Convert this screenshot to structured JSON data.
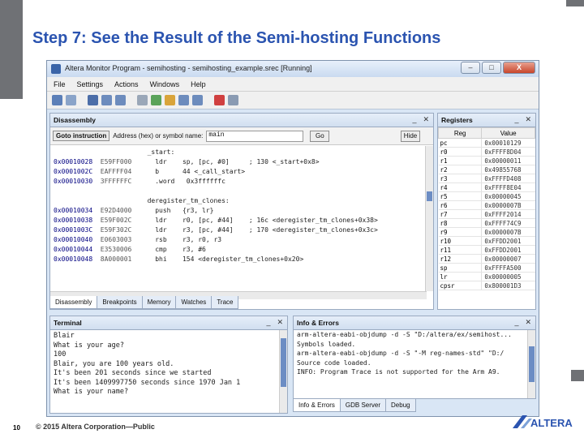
{
  "slide": {
    "title": "Step 7: See the Result of the Semi-hosting Functions",
    "page_number": "10",
    "copyright": "© 2015 Altera Corporation—Public",
    "logo_text": "ALTERA"
  },
  "window": {
    "title": "Altera Monitor Program - semihosting - semihosting_example.srec [Running]",
    "buttons": {
      "minimize": "–",
      "maximize": "□",
      "close": "X"
    }
  },
  "menu": [
    "File",
    "Settings",
    "Actions",
    "Windows",
    "Help"
  ],
  "toolbar_icons": [
    "save-icon",
    "open-icon",
    "compile-icon",
    "load-icon",
    "download-icon",
    "restart-icon",
    "continue-icon",
    "pause-icon",
    "step-icon",
    "step-over-icon",
    "breakpoint-icon",
    "refresh-icon"
  ],
  "disassembly": {
    "title": "Disassembly",
    "goto_label": "Goto instruction",
    "address_label": "Address (hex) or symbol name:",
    "address_value": "main",
    "go_button": "Go",
    "hide_button": "Hide",
    "lines": [
      {
        "addr": "",
        "enc": "",
        "asm": "_start:"
      },
      {
        "addr": "0x00010028",
        "enc": "E59FF000",
        "asm": "    ldr    sp, [pc, #0]     ; 130 <_start+0x8>"
      },
      {
        "addr": "0x0001002C",
        "enc": "EAFFFF04",
        "asm": "    b      44 <_call_start>"
      },
      {
        "addr": "0x00010030",
        "enc": "3FFFFFFC",
        "asm": "    .word   0x3ffffffc"
      },
      {
        "addr": "",
        "enc": "",
        "asm": ""
      },
      {
        "addr": "",
        "enc": "",
        "asm": "deregister_tm_clones:"
      },
      {
        "addr": "0x00010034",
        "enc": "E92D4000",
        "asm": "    push   {r3, lr}"
      },
      {
        "addr": "0x00010038",
        "enc": "E59F002C",
        "asm": "    ldr    r0, [pc, #44]    ; 16c <deregister_tm_clones+0x38>"
      },
      {
        "addr": "0x0001003C",
        "enc": "E59F302C",
        "asm": "    ldr    r3, [pc, #44]    ; 170 <deregister_tm_clones+0x3c>"
      },
      {
        "addr": "0x00010040",
        "enc": "E0603003",
        "asm": "    rsb    r3, r0, r3"
      },
      {
        "addr": "0x00010044",
        "enc": "E3530006",
        "asm": "    cmp    r3, #6"
      },
      {
        "addr": "0x00010048",
        "enc": "8A000001",
        "asm": "    bhi    154 <deregister_tm_clones+0x20>"
      }
    ],
    "tabs": [
      "Disassembly",
      "Breakpoints",
      "Memory",
      "Watches",
      "Trace"
    ]
  },
  "registers": {
    "title": "Registers",
    "col_reg": "Reg",
    "col_value": "Value",
    "rows": [
      {
        "reg": "pc",
        "value": "0x00010129"
      },
      {
        "reg": "r0",
        "value": "0xFFFF8D04"
      },
      {
        "reg": "r1",
        "value": "0x00000011"
      },
      {
        "reg": "r2",
        "value": "0x49855768"
      },
      {
        "reg": "r3",
        "value": "0xFFFFD408"
      },
      {
        "reg": "r4",
        "value": "0xFFFF8E04"
      },
      {
        "reg": "r5",
        "value": "0x00000045"
      },
      {
        "reg": "r6",
        "value": "0x0000007B"
      },
      {
        "reg": "r7",
        "value": "0xFFFF2014"
      },
      {
        "reg": "r8",
        "value": "0xFFFF74C9"
      },
      {
        "reg": "r9",
        "value": "0x0000007B"
      },
      {
        "reg": "r10",
        "value": "0xFFDD2001"
      },
      {
        "reg": "r11",
        "value": "0xFFDD2001"
      },
      {
        "reg": "r12",
        "value": "0x00000007"
      },
      {
        "reg": "sp",
        "value": "0xFFFFA500"
      },
      {
        "reg": "lr",
        "value": "0x00000005"
      },
      {
        "reg": "cpsr",
        "value": "0x800001D3"
      }
    ]
  },
  "terminal": {
    "title": "Terminal",
    "lines": [
      "Blair",
      "What is your age?",
      "100",
      "Blair, you are 100 years old.",
      "It's been 201 seconds since we started",
      "It's been 1409997750 seconds since 1970 Jan 1",
      "What is your name?"
    ]
  },
  "info": {
    "title": "Info & Errors",
    "lines": [
      "arm-altera-eabi-objdump -d -S \"D:/altera/ex/semihost...",
      "Symbols loaded.",
      "arm-altera-eabi-objdump -d -S \"-M reg-names-std\" \"D:/",
      "Source code loaded.",
      "INFO: Program Trace is not supported for the Arm A9."
    ],
    "tabs": [
      "Info & Errors",
      "GDB Server",
      "Debug"
    ]
  },
  "colors": {
    "title": "#2b54b0",
    "brand": "#2b54b0"
  }
}
